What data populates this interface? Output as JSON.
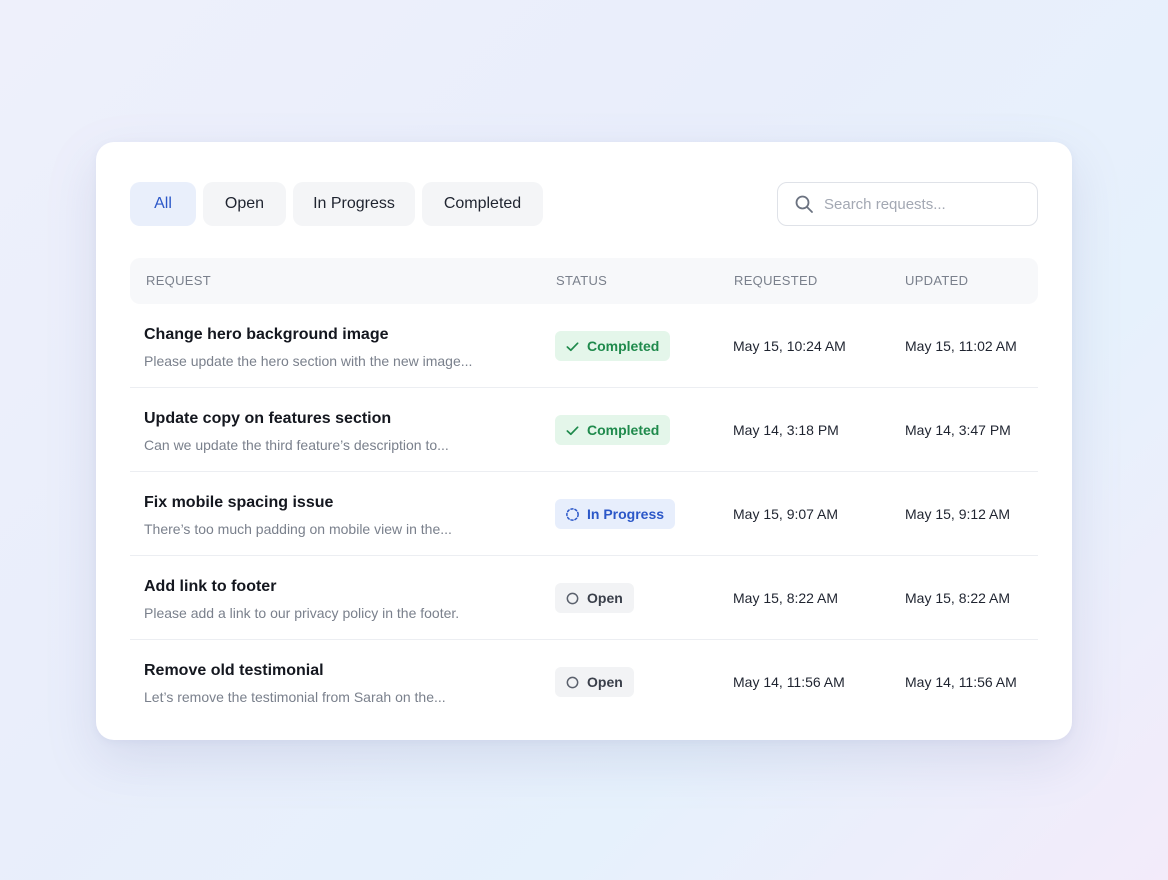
{
  "tabs": [
    {
      "label": "All",
      "active": true
    },
    {
      "label": "Open",
      "active": false
    },
    {
      "label": "In Progress",
      "active": false
    },
    {
      "label": "Completed",
      "active": false
    }
  ],
  "search": {
    "placeholder": "Search requests...",
    "icon": "search-icon"
  },
  "table": {
    "columns": [
      "REQUEST",
      "STATUS",
      "REQUESTED",
      "UPDATED"
    ],
    "rows": [
      {
        "title": "Change hero background image",
        "description": "Please update the hero section with the new image...",
        "status": "Completed",
        "requested": "May 15, 10:24 AM",
        "updated": "May 15, 11:02 AM"
      },
      {
        "title": "Update copy on features section",
        "description": "Can we update the third feature’s description to...",
        "status": "Completed",
        "requested": "May 14, 3:18 PM",
        "updated": "May 14, 3:47 PM"
      },
      {
        "title": "Fix mobile spacing issue",
        "description": "There’s too much padding on mobile view in the...",
        "status": "In Progress",
        "requested": "May 15, 9:07 AM",
        "updated": "May 15, 9:12 AM"
      },
      {
        "title": "Add link to footer",
        "description": "Please add a link to our privacy policy in the footer.",
        "status": "Open",
        "requested": "May 15, 8:22 AM",
        "updated": "May 15, 8:22 AM"
      },
      {
        "title": "Remove old testimonial",
        "description": "Let’s remove the testimonial from Sarah on the...",
        "status": "Open",
        "requested": "May 14, 11:56 AM",
        "updated": "May 14, 11:56 AM"
      }
    ]
  },
  "colors": {
    "accent": "#2b57c8",
    "completed": "#1f8a4c",
    "completed_bg": "#e4f6ea",
    "progress_bg": "#e7eefc",
    "open_bg": "#f2f3f5"
  }
}
